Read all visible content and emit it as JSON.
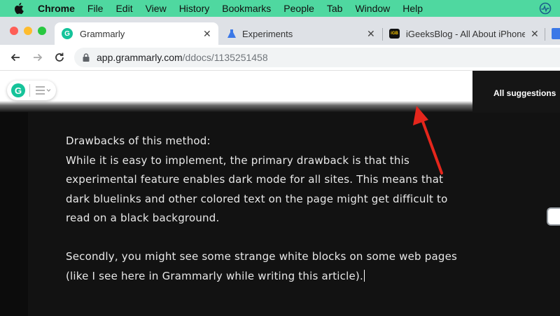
{
  "menubar": {
    "items": [
      "Chrome",
      "File",
      "Edit",
      "View",
      "History",
      "Bookmarks",
      "People",
      "Tab",
      "Window",
      "Help"
    ],
    "icons": {
      "apple": "apple-logo-icon",
      "status": "activity-monitor-icon"
    }
  },
  "tabs": [
    {
      "title": "Grammarly",
      "icon": "grammarly-icon",
      "active": true
    },
    {
      "title": "Experiments",
      "icon": "flask-icon",
      "active": false
    },
    {
      "title": "iGeeksBlog - All About iPhone,",
      "icon": "igeeksblog-icon",
      "active": false
    }
  ],
  "toolbar": {
    "url_host": "app.grammarly.com",
    "url_path": "/ddocs/1135251458"
  },
  "page": {
    "suggestions_label": "All suggestions",
    "paragraphs": [
      "Drawbacks of this method:",
      "While it is easy to implement, the primary drawback is that this experimental feature enables dark mode for all sites. This means that dark bluelinks and other colored text on the page might get difficult to read on a black background.",
      "Secondly, you might see some strange white blocks on some web pages (like I see here in Grammarly while writing this article)."
    ]
  },
  "colors": {
    "menubar_bg": "#4fd8a0",
    "grammarly_green": "#15c39a",
    "annotation_arrow": "#e5261c",
    "editor_bg": "#121212"
  }
}
